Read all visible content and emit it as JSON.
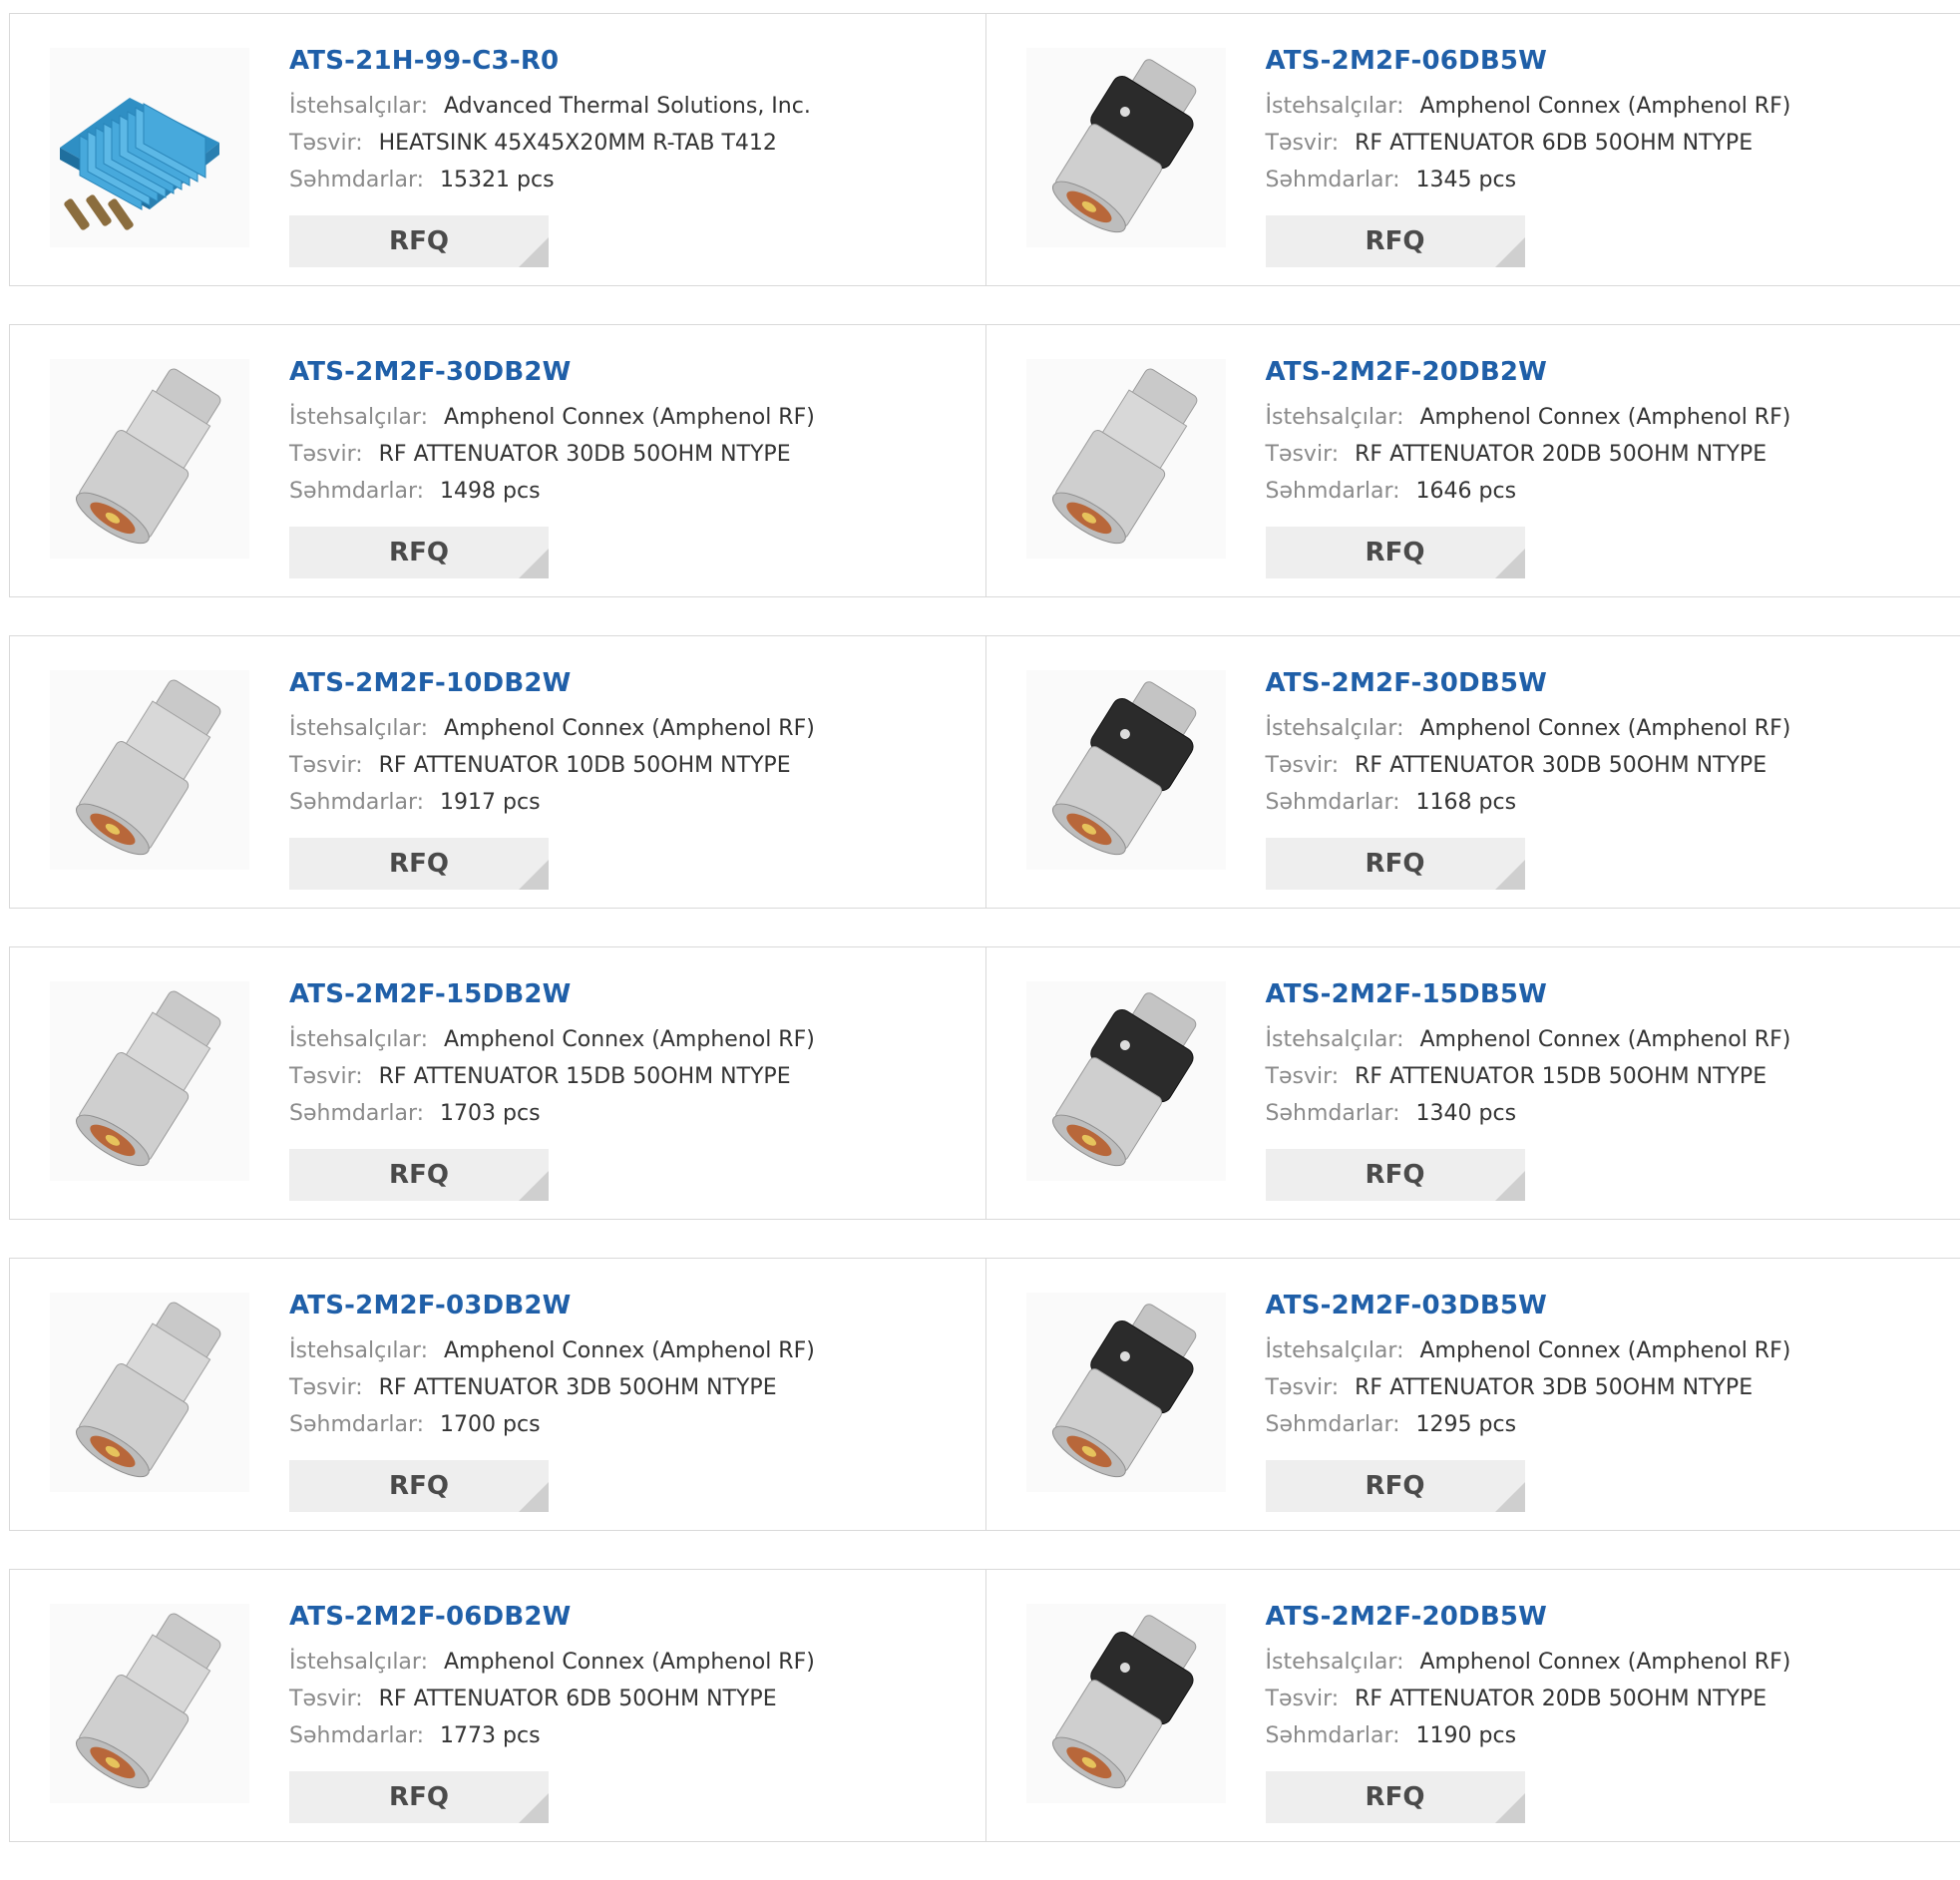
{
  "labels": {
    "manufacturer": "İstehsalçılar:",
    "description": "Təsvir:",
    "stock": "Səhmdarlar:"
  },
  "rfq_label": "RFQ",
  "products": [
    {
      "part": "ATS-21H-99-C3-R0",
      "manufacturer": "Advanced Thermal Solutions, Inc.",
      "description": "HEATSINK 45X45X20MM R-TAB T412",
      "stock": "15321 pcs",
      "image": "heatsink"
    },
    {
      "part": "ATS-2M2F-06DB5W",
      "manufacturer": "Amphenol Connex (Amphenol RF)",
      "description": "RF ATTENUATOR 6DB 50OHM NTYPE",
      "stock": "1345 pcs",
      "image": "attenuator-black"
    },
    {
      "part": "ATS-2M2F-30DB2W",
      "manufacturer": "Amphenol Connex (Amphenol RF)",
      "description": "RF ATTENUATOR 30DB 50OHM NTYPE",
      "stock": "1498 pcs",
      "image": "attenuator-silver"
    },
    {
      "part": "ATS-2M2F-20DB2W",
      "manufacturer": "Amphenol Connex (Amphenol RF)",
      "description": "RF ATTENUATOR 20DB 50OHM NTYPE",
      "stock": "1646 pcs",
      "image": "attenuator-silver"
    },
    {
      "part": "ATS-2M2F-10DB2W",
      "manufacturer": "Amphenol Connex (Amphenol RF)",
      "description": "RF ATTENUATOR 10DB 50OHM NTYPE",
      "stock": "1917 pcs",
      "image": "attenuator-silver"
    },
    {
      "part": "ATS-2M2F-30DB5W",
      "manufacturer": "Amphenol Connex (Amphenol RF)",
      "description": "RF ATTENUATOR 30DB 50OHM NTYPE",
      "stock": "1168 pcs",
      "image": "attenuator-black"
    },
    {
      "part": "ATS-2M2F-15DB2W",
      "manufacturer": "Amphenol Connex (Amphenol RF)",
      "description": "RF ATTENUATOR 15DB 50OHM NTYPE",
      "stock": "1703 pcs",
      "image": "attenuator-silver"
    },
    {
      "part": "ATS-2M2F-15DB5W",
      "manufacturer": "Amphenol Connex (Amphenol RF)",
      "description": "RF ATTENUATOR 15DB 50OHM NTYPE",
      "stock": "1340 pcs",
      "image": "attenuator-black"
    },
    {
      "part": "ATS-2M2F-03DB2W",
      "manufacturer": "Amphenol Connex (Amphenol RF)",
      "description": "RF ATTENUATOR 3DB 50OHM NTYPE",
      "stock": "1700 pcs",
      "image": "attenuator-silver"
    },
    {
      "part": "ATS-2M2F-03DB5W",
      "manufacturer": "Amphenol Connex (Amphenol RF)",
      "description": "RF ATTENUATOR 3DB 50OHM NTYPE",
      "stock": "1295 pcs",
      "image": "attenuator-black"
    },
    {
      "part": "ATS-2M2F-06DB2W",
      "manufacturer": "Amphenol Connex (Amphenol RF)",
      "description": "RF ATTENUATOR 6DB 50OHM NTYPE",
      "stock": "1773 pcs",
      "image": "attenuator-silver"
    },
    {
      "part": "ATS-2M2F-20DB5W",
      "manufacturer": "Amphenol Connex (Amphenol RF)",
      "description": "RF ATTENUATOR 20DB 50OHM NTYPE",
      "stock": "1190 pcs",
      "image": "attenuator-black"
    }
  ]
}
